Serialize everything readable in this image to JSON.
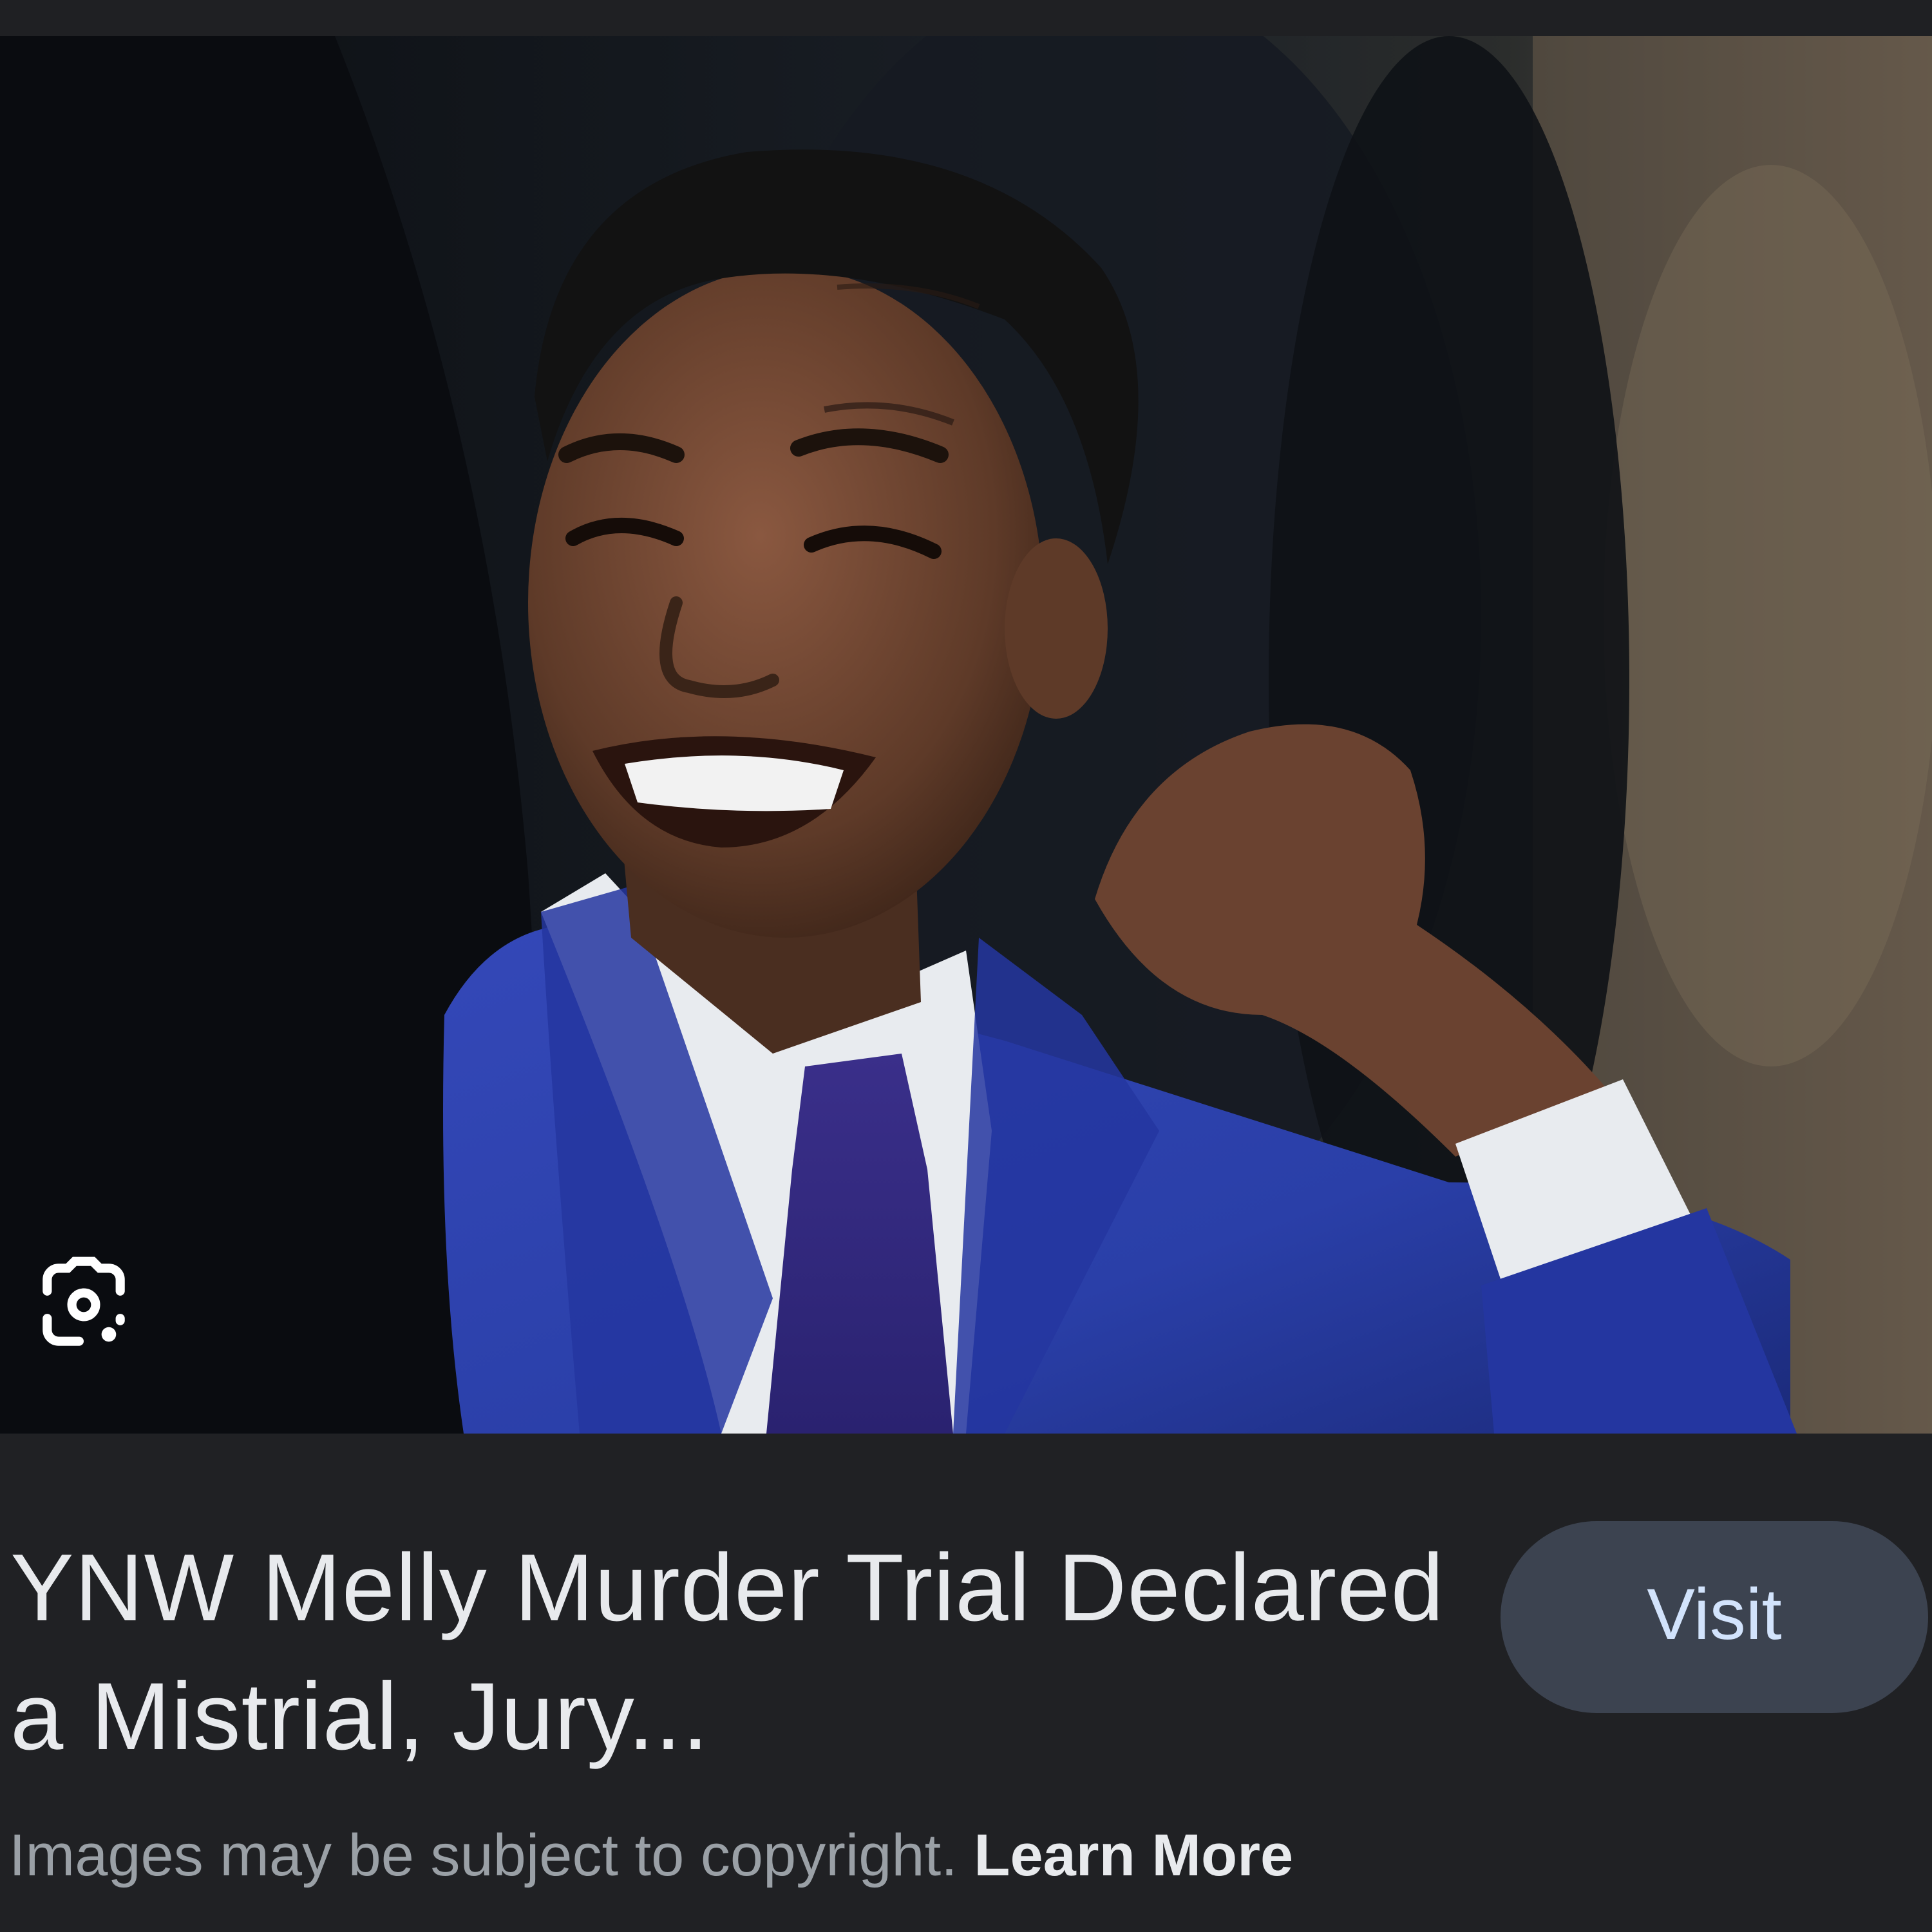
{
  "result": {
    "title": "YNW Melly Murder Trial Declared a Mistrial, Jury...",
    "visit_label": "Visit",
    "lens_icon": "google-lens-icon"
  },
  "footer": {
    "copyright_text": "Images may be subject to copyright.",
    "learn_more_label": "Learn More"
  },
  "colors": {
    "background": "#202124",
    "title_text": "#e8eaed",
    "visit_button_bg": "#3c4350",
    "visit_button_text": "#d2e3fc",
    "secondary_text": "#9aa0a6",
    "suit_blue": "#2a3fa8"
  }
}
